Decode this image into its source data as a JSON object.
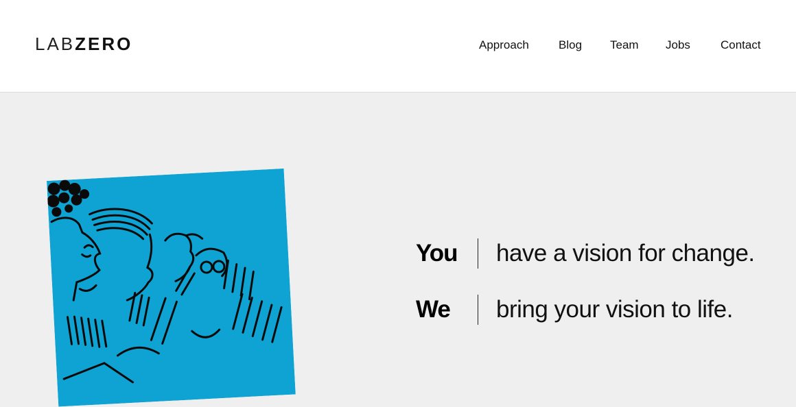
{
  "header": {
    "logo": {
      "light": "LAB",
      "bold": "ZERO"
    },
    "nav": [
      {
        "label": "Approach"
      },
      {
        "label": "Blog"
      },
      {
        "label": "Team"
      },
      {
        "label": "Jobs"
      },
      {
        "label": "Contact"
      }
    ]
  },
  "hero": {
    "illustration": {
      "icon": "people-sketch-illustration",
      "color": "#0ea3d3"
    },
    "taglines": [
      {
        "who": "You",
        "text": "have a vision for change."
      },
      {
        "who": "We",
        "text": "bring your vision to life."
      }
    ]
  },
  "colors": {
    "background": "#efefef",
    "header": "#ffffff",
    "accent": "#0ea3d3"
  }
}
